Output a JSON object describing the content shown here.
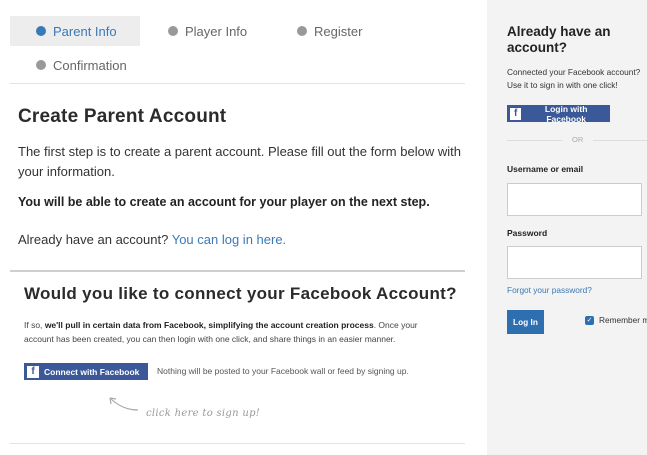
{
  "steps": [
    {
      "label": "Parent Info",
      "active": true
    },
    {
      "label": "Player Info",
      "active": false
    },
    {
      "label": "Register",
      "active": false
    },
    {
      "label": "Confirmation",
      "active": false
    }
  ],
  "main": {
    "title": "Create Parent Account",
    "intro": "The first step is to create a parent account. Please fill out the form below with your information.",
    "next_step": "You will be able to create an account for your player on the next step.",
    "login_prefix": "Already have an account?",
    "login_link": "You can log in here."
  },
  "facebook": {
    "title": "Would you like to connect your Facebook Account?",
    "desc_prefix": "If so,",
    "desc_bold": "we'll pull in certain data from Facebook, simplifying the account creation process",
    "desc_suffix": ". Once your account has been created, you can then login with one click, and share things in an easier manner.",
    "connect_label": "Connect with Facebook",
    "note": "Nothing will be posted to your Facebook wall or feed by signing up.",
    "hint": "click here to sign up!"
  },
  "sidebar": {
    "title": "Already have an account?",
    "desc": "Connected your Facebook account? Use it to sign in with one click!",
    "fb_login_label": "Login with Facebook",
    "or_text": "OR",
    "username_label": "Username or email",
    "username_value": "",
    "password_label": "Password",
    "password_value": "",
    "forgot_link": "Forgot your password?",
    "login_button": "Log In",
    "remember_label": "Remember me",
    "remember_checked": true
  },
  "colors": {
    "accent": "#3a79b8",
    "facebook": "#3b5998",
    "sidebar_bg": "#f3f3f3"
  }
}
